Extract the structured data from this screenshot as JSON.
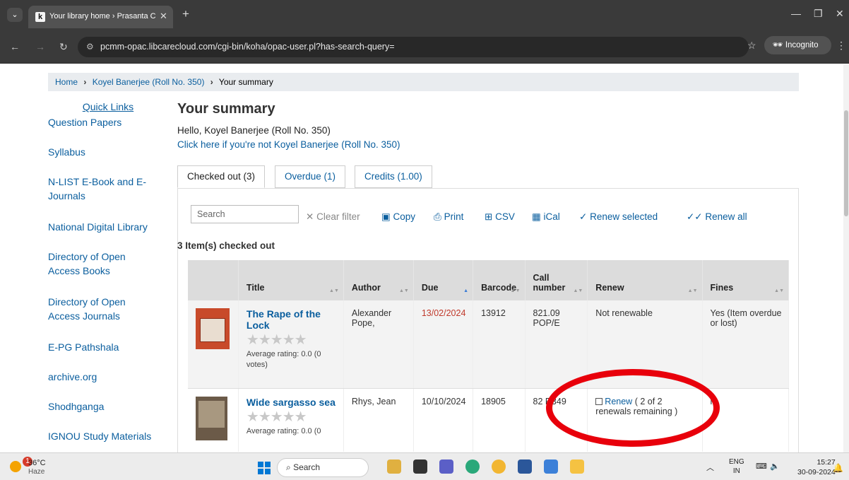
{
  "browser": {
    "tab_favicon": "k",
    "tab_title": "Your library home › Prasanta Ch",
    "url": "pcmm-opac.libcarecloud.com/cgi-bin/koha/opac-user.pl?has-search-query=",
    "incognito_label": "Incognito"
  },
  "breadcrumb": {
    "home": "Home",
    "user": "Koyel Banerjee (Roll No. 350)",
    "current": "Your summary"
  },
  "sidebar": {
    "title": "Quick Links",
    "items": [
      "Question Papers",
      "Syllabus",
      "N-LIST E-Book and E-Journals",
      "National Digital Library",
      "Directory of Open Access Books",
      "Directory of Open Access Journals",
      "E-PG Pathshala",
      "archive.org",
      "Shodhganga",
      "IGNOU Study Materials"
    ]
  },
  "main": {
    "heading": "Your summary",
    "hello": "Hello, Koyel Banerjee (Roll No. 350)",
    "not_you": "Click here if you're not Koyel Banerjee (Roll No. 350)",
    "tabs": [
      "Checked out (3)",
      "Overdue (1)",
      "Credits (1.00)"
    ],
    "search_placeholder": "Search",
    "tools": {
      "clear": "Clear filter",
      "copy": "Copy",
      "print": "Print",
      "csv": "CSV",
      "ical": "iCal",
      "renew_selected": "Renew selected",
      "renew_all": "Renew all"
    },
    "count": "3 Item(s) checked out",
    "columns": [
      "Title",
      "Author",
      "Due",
      "Barcode",
      "Call number",
      "Renew",
      "Fines"
    ],
    "rows": [
      {
        "title": "The Rape of the Lock",
        "rating": "Average rating: 0.0 (0 votes)",
        "author": "Alexander Pope,",
        "due": "13/02/2024",
        "barcode": "13912",
        "call_number": "821.09 POP/E",
        "renew": "Not renewable",
        "fines": "Yes (Item overdue or lost)"
      },
      {
        "title": "Wide sargasso sea",
        "rating": "Average rating: 0.0 (0",
        "author": "Rhys, Jean",
        "due": "10/10/2024",
        "barcode": "18905",
        "call_number": "82 R349",
        "renew_link": "Renew",
        "renew_note": "( 2 of 2 renewals remaining )",
        "fines": "lo"
      }
    ]
  },
  "taskbar": {
    "badge": "1",
    "temperature": "36°C",
    "condition": "Haze",
    "search": "Search",
    "lang1": "ENG",
    "lang2": "IN",
    "time": "15:27",
    "date": "30-09-2024"
  },
  "colors": {
    "link": "#0a5e9e",
    "overdue": "#c0392b",
    "annotation": "#e8000b"
  }
}
